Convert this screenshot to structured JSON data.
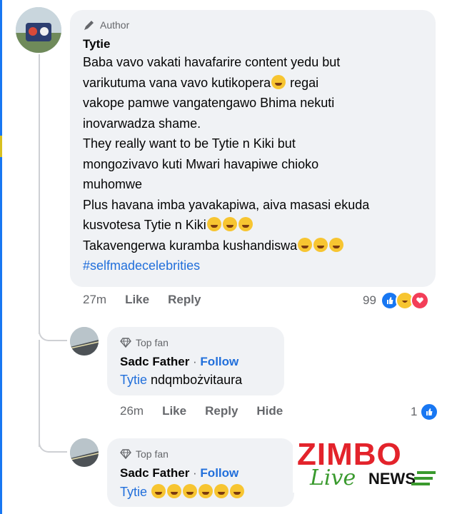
{
  "post": {
    "badge": "Author",
    "author": "Tytie",
    "lines": [
      "Baba vavo vakati havafarire content yedu but",
      "varikutuma vana vavo kutikopera",
      "vakope pamwe vangatengawo Bhima nekuti",
      "inovarwadza shame.",
      "They really want to be Tytie n Kiki but",
      "mongozivavo kuti Mwari havapiwe chioko",
      "muhomwe",
      "Plus havana imba yavakapiwa, aiva masasi ekuda",
      "kusvotesa Tytie n Kiki",
      "Takavengerwa kuramba kushandiswa"
    ],
    "line2_suffix": "regai",
    "hashtag": "#selfmadecelebrities",
    "time": "27m",
    "like": "Like",
    "reply": "Reply",
    "reaction_count": "99"
  },
  "replies": [
    {
      "badge": "Top fan",
      "name": "Sadc Father",
      "separator": " · ",
      "follow": "Follow",
      "mention": "Tytie",
      "text": "ndqmbożvitaura",
      "time": "26m",
      "like": "Like",
      "reply": "Reply",
      "hide": "Hide",
      "reaction_count": "1"
    },
    {
      "badge": "Top fan",
      "name": "Sadc Father",
      "separator": " · ",
      "follow": "Follow",
      "mention": "Tytie"
    }
  ],
  "watermark": {
    "brand": "ZIMBO",
    "sub1": "Live",
    "sub2": "NEWS"
  },
  "colors": {
    "accent": "#1877f2",
    "link": "#216fdb",
    "bubble": "#f0f2f5",
    "logo_red": "#e3232b",
    "logo_green": "#3a9a2e"
  }
}
